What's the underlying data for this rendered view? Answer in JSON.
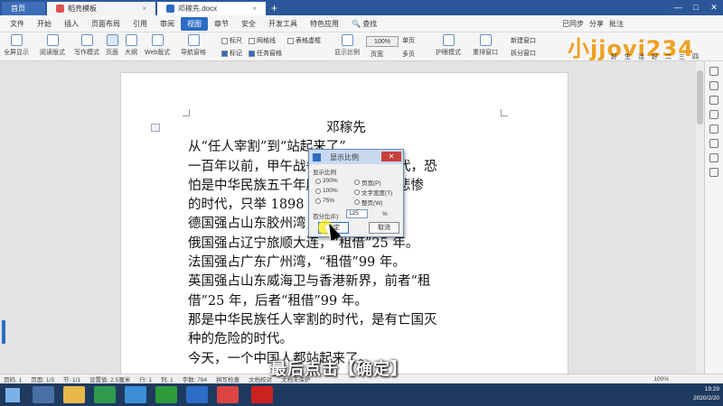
{
  "tabs": {
    "home": "首页",
    "doc1": "稻壳模板",
    "doc2": "邓稼先.docx"
  },
  "menu": [
    "文件",
    "开始",
    "插入",
    "页面布局",
    "引用",
    "审阅",
    "视图",
    "章节",
    "安全",
    "开发工具",
    "特色应用"
  ],
  "menu_selected": "视图",
  "menu_right": {
    "search": "查找",
    "sync": "已同步",
    "share": "分享",
    "annot": "批注"
  },
  "ribbon": {
    "fullscreen": "全屏显示",
    "read": "阅读版式",
    "write": "写作模式",
    "page": "页面",
    "outline": "大纲",
    "web": "Web版式",
    "nav": "导航窗格",
    "ruler": "标尺",
    "grid": "网格线",
    "table": "表格虚框",
    "mark": "标记",
    "task": "任务窗格",
    "zoom_ratio": "显示比例",
    "zoom_pct": "100%",
    "single": "单页",
    "multi": "多页",
    "pageview": "页宽",
    "eye": "护眼模式",
    "rearrange": "重排窗口",
    "newwin": "新建窗口",
    "split": "拆分窗口"
  },
  "logo": {
    "text": "小jjovi234",
    "tagline": "好生活好二三四"
  },
  "document": {
    "title": "邓稼先",
    "lines": [
      "从“任人宰割”到“站起来了”",
      "一百年以前，甲午战争，八国联军时代，恐",
      "怕是中华民族五千年历史上最黑暗最悲惨",
      "的时代，只举 1898 年为例：",
      "德国强占山东胶州湾，“租借”99 年。",
      "俄国强占辽宁旅顺大连，“租借”25 年。",
      "法国强占广东广州湾，“租借”99 年。",
      "英国强占山东威海卫与香港新界，前者“租",
      "借”25 年，后者“租借”99 年。",
      "那是中华民族任人宰割的时代，是有亡国灭",
      "种的危险的时代。",
      "今天，一个中国人都站起来了。"
    ]
  },
  "dialog": {
    "title": "显示比例",
    "group": "显示比例",
    "options": [
      "200%",
      "100%",
      "75%",
      "页宽(P)",
      "文字宽度(T)",
      "整页(W)"
    ],
    "pct_label": "百分比(E):",
    "pct_value": "125",
    "pct_unit": "%",
    "ok": "确定",
    "cancel": "取消"
  },
  "subtitle": "最后点击【确定】",
  "status": {
    "page": "页码: 1",
    "pages": "页面: 1/3",
    "section": "节: 1/1",
    "setting": "设置值: 2.5厘米",
    "row": "行: 1",
    "col": "列: 1",
    "words": "字数: 784",
    "spell": "拼写检查",
    "proof": "文档校对",
    "unsaved": "文档未保护",
    "zoom": "100%"
  },
  "tray": {
    "time": "19:29",
    "date": "2020/2/20"
  }
}
